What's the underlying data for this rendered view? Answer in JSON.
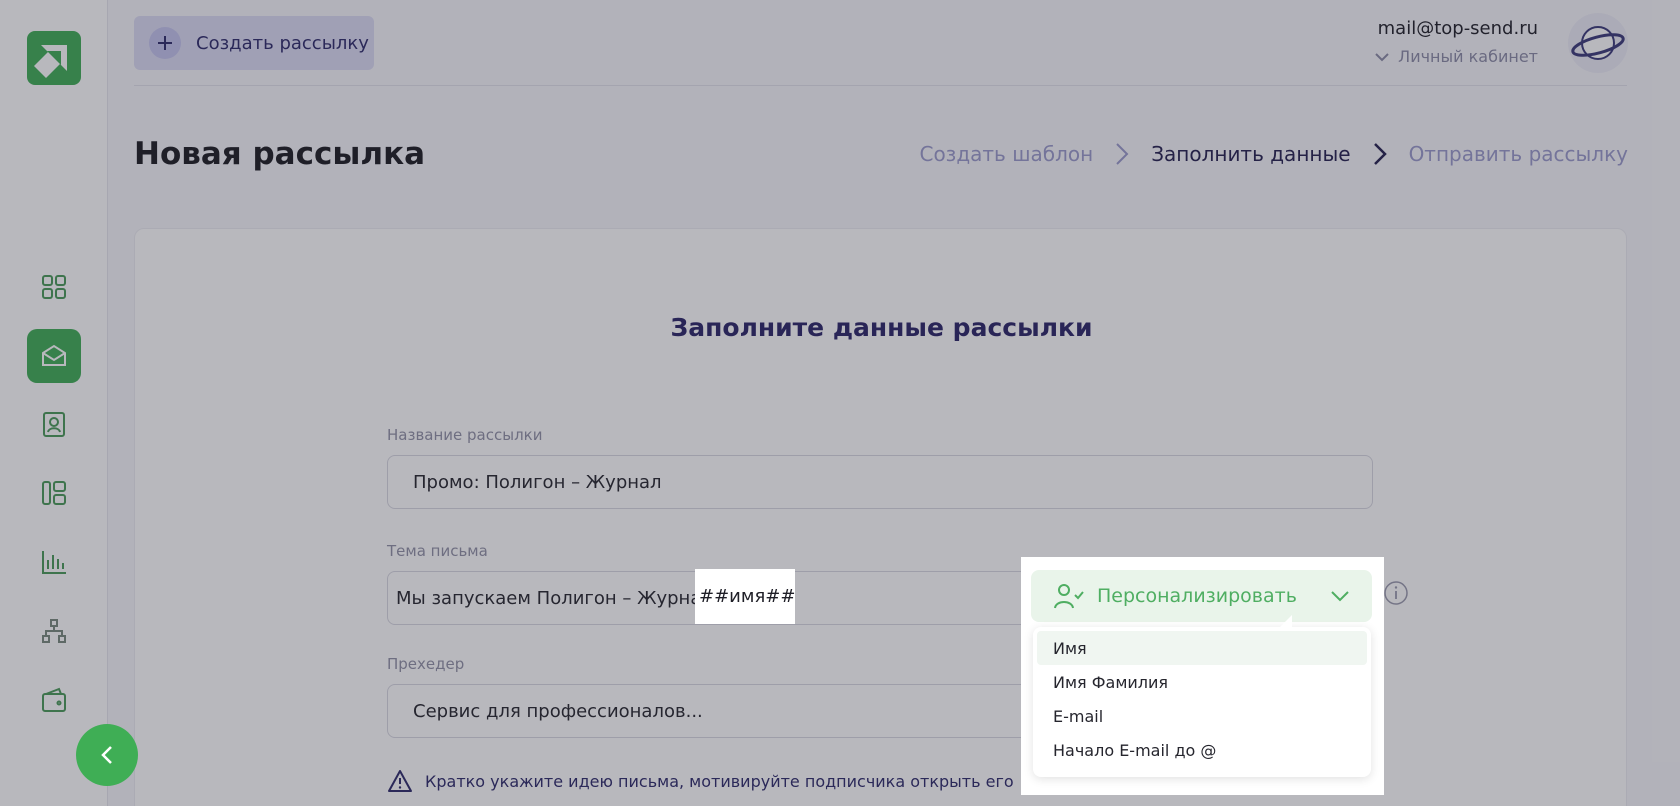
{
  "header": {
    "create_button_label": "Создать рассылку",
    "user_email": "mail@top-send.ru",
    "cabinet_label": "Личный кабинет"
  },
  "page": {
    "title": "Новая рассылка",
    "steps": [
      "Создать шаблон",
      "Заполнить данные",
      "Отправить рассылку"
    ],
    "current_step": 1
  },
  "form": {
    "heading": "Заполните данные рассылки",
    "name_label": "Название рассылки",
    "name_value": "Промо: Полигон – Журнал",
    "subject_label": "Тема письма",
    "subject_value": "Мы запускаем Полигон – Журнал",
    "subject_tag": "##имя##",
    "preheader_label": "Прехедер",
    "preheader_value": "Сервис для профессионалов...",
    "hint": "Кратко укажите идею письма, мотивируйте подписчика открыть его"
  },
  "personalize": {
    "button_label": "Персонализировать",
    "options": [
      "Имя",
      "Имя Фамилия",
      "E-mail",
      "Начало E-mail до @"
    ],
    "highlighted_option": 0
  },
  "sidebar": {
    "items": [
      "dashboard-icon",
      "mailing-icon",
      "contacts-icon",
      "templates-icon",
      "statistics-icon",
      "structure-icon",
      "wallet-icon"
    ],
    "active_index": 1
  },
  "colors": {
    "accent_green": "#3fae55",
    "accent_purple": "#2b2468",
    "overlay": "rgba(40,40,55,0.33)"
  }
}
